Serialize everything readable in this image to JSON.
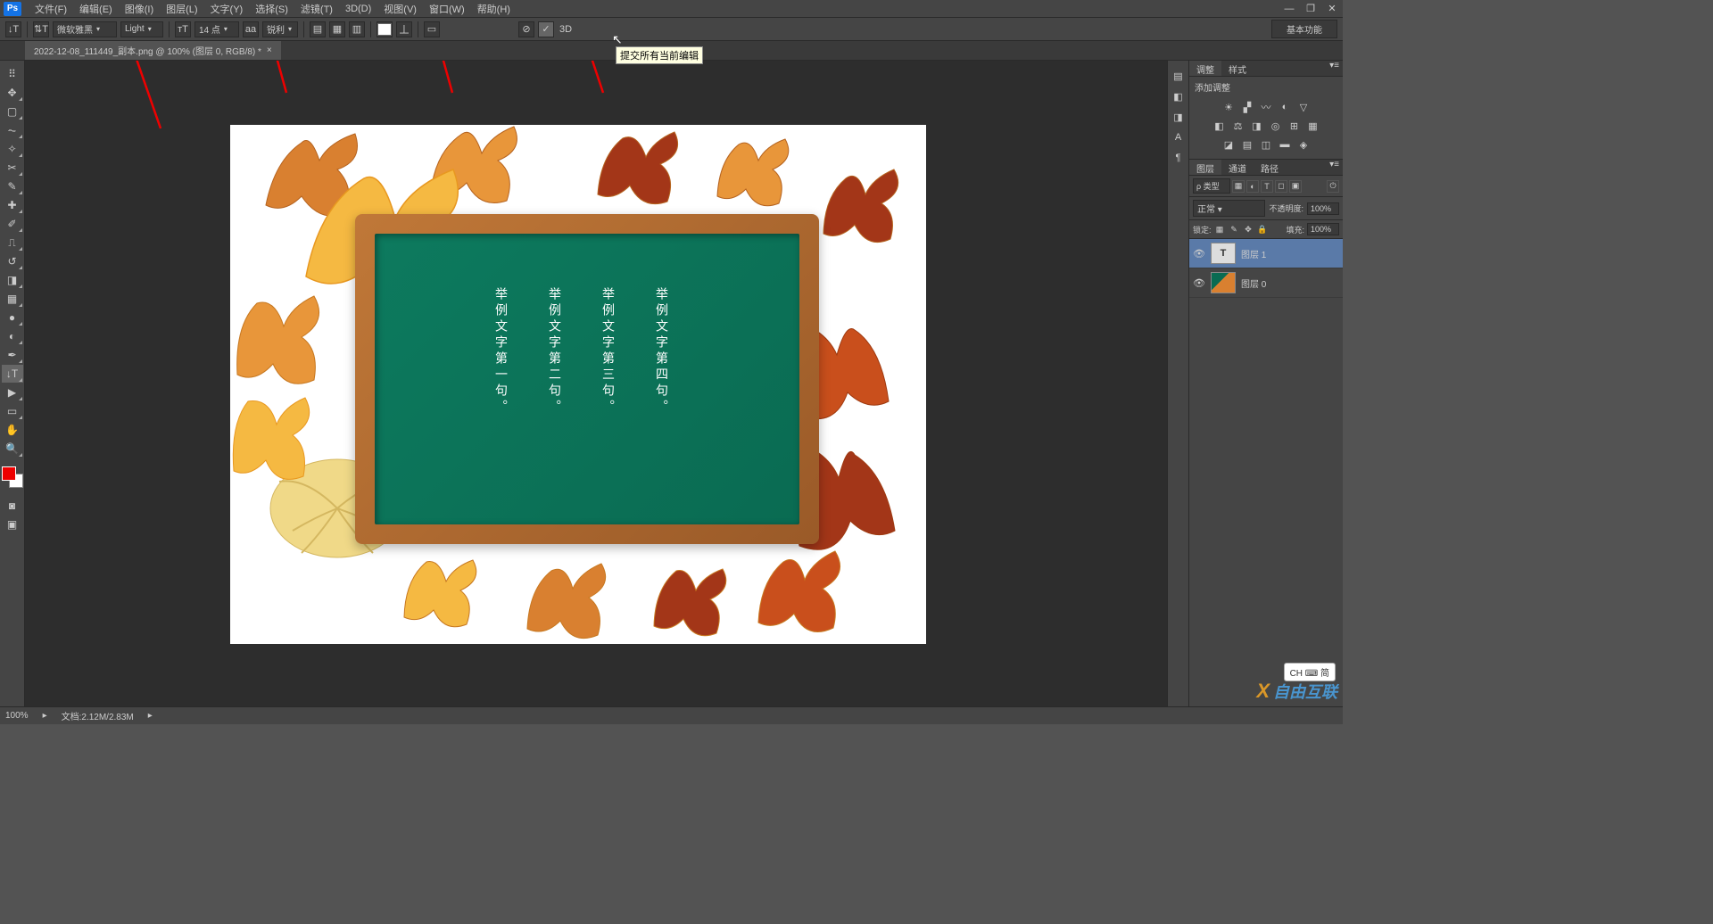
{
  "app": {
    "logo_text": "Ps"
  },
  "menu": {
    "file": "文件(F)",
    "edit": "编辑(E)",
    "image": "图像(I)",
    "layer": "图层(L)",
    "type": "文字(Y)",
    "select": "选择(S)",
    "filter": "滤镜(T)",
    "3d": "3D(D)",
    "view": "视图(V)",
    "window": "窗口(W)",
    "help": "帮助(H)"
  },
  "window_controls": {
    "min": "—",
    "restore": "❐",
    "close": "✕"
  },
  "options": {
    "font_family": "微软雅黑",
    "font_style": "Light",
    "font_size": "14 点",
    "antialiasing": "锐利",
    "workspace": "基本功能",
    "commit_3d": "3D"
  },
  "tooltip": {
    "commit": "提交所有当前编辑"
  },
  "tab": {
    "title": "2022-12-08_111449_副本.png @ 100% (图层 0, RGB/8) *",
    "close": "×"
  },
  "canvas_text": {
    "line1": "举例文字第一句。",
    "line2": "举例文字第二句。",
    "line3": "举例文字第三句。",
    "line4": "举例文字第四句。"
  },
  "panels": {
    "adjust_tab": "调整",
    "styles_tab": "样式",
    "adjust_label": "添加调整",
    "layers_tab": "图层",
    "channels_tab": "通道",
    "paths_tab": "路径",
    "filter_type": "ρ 类型",
    "blend_mode": "正常",
    "opacity_label": "不透明度:",
    "opacity_val": "100%",
    "lock_label": "锁定:",
    "fill_label": "填充:",
    "fill_val": "100%",
    "layer1_name": "图层 1",
    "layer1_icon": "T",
    "layer0_name": "图层 0"
  },
  "status": {
    "zoom": "100%",
    "docinfo": "文档:2.12M/2.83M"
  },
  "ime": {
    "text": "CH ⌨ 简"
  },
  "watermark": {
    "x": "X",
    "text": "自由互联"
  }
}
